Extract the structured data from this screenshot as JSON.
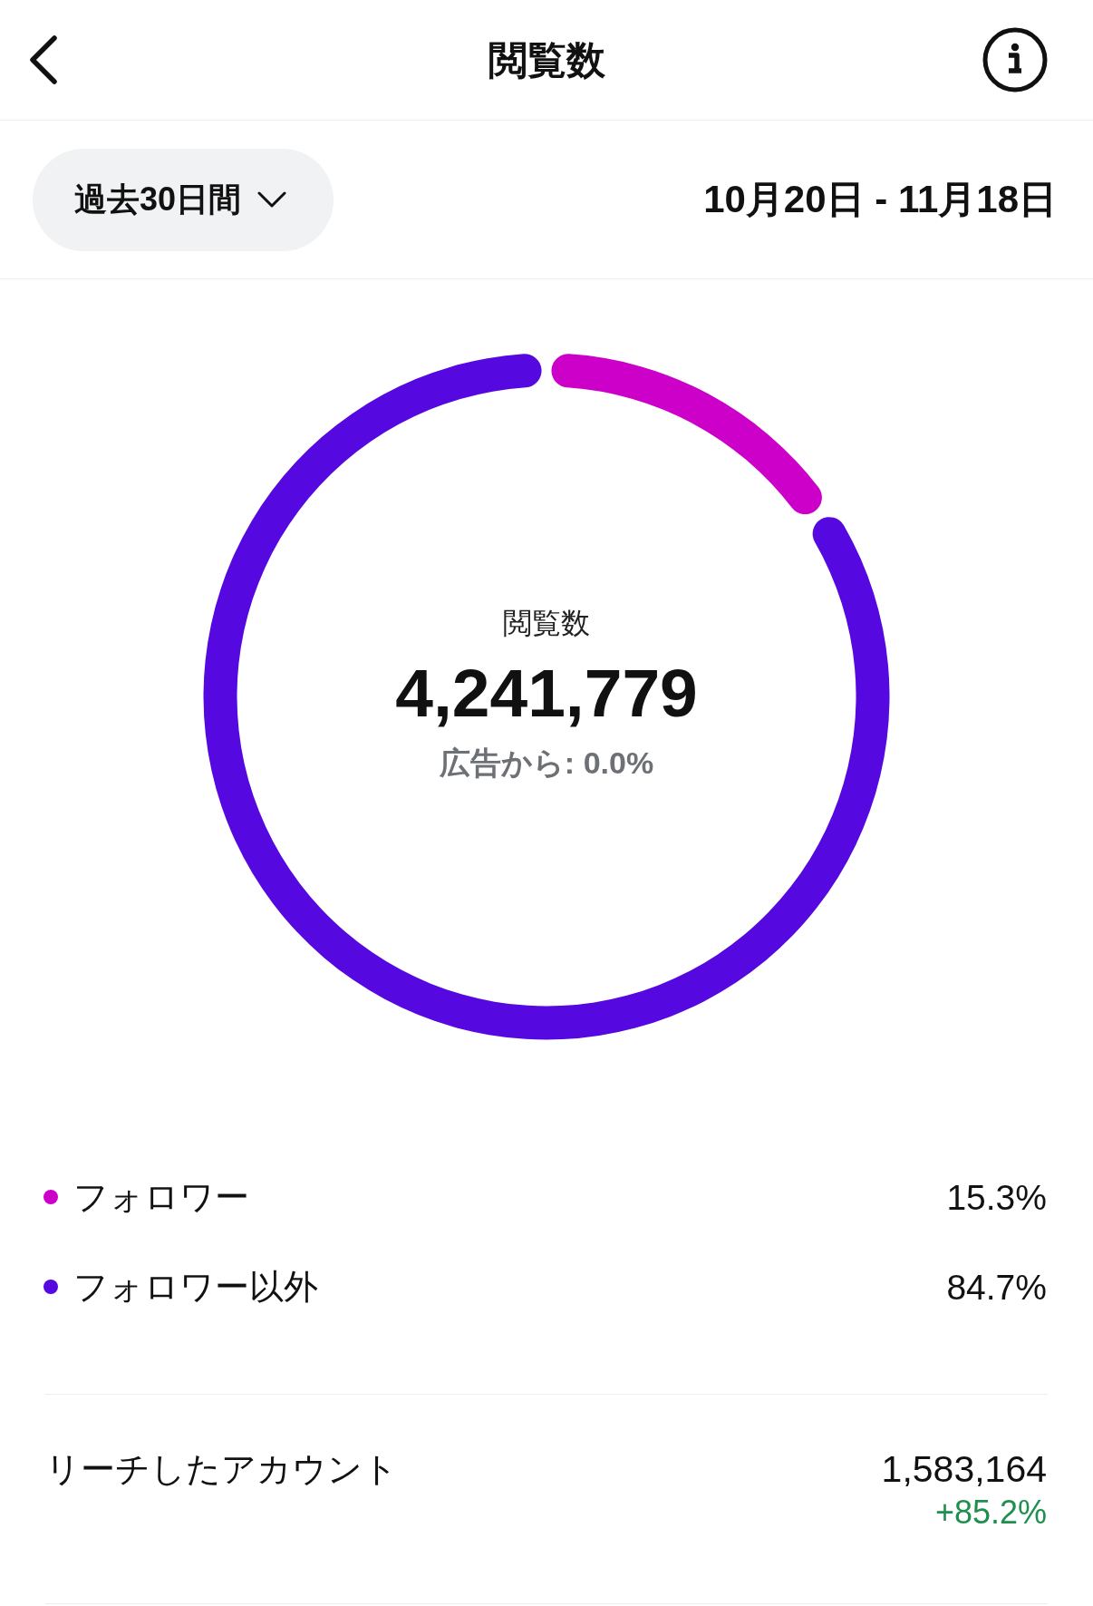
{
  "header": {
    "title": "閲覧数"
  },
  "filter": {
    "period": "過去30日間",
    "date_range": "10月20日 - 11月18日"
  },
  "summary": {
    "label": "閲覧数",
    "total": "4,241,779",
    "ads_share": "広告から: 0.0%",
    "chart_data": {
      "type": "donut",
      "categories": [
        "フォロワー",
        "フォロワー以外"
      ],
      "values": [
        15.3,
        84.7
      ]
    }
  },
  "legend": [
    {
      "value": "15.3%",
      "color": "#cc00c8"
    },
    {
      "value": "84.7%",
      "color": "#5508e0"
    }
  ],
  "metrics": [
    {
      "label": "リーチしたアカウント",
      "value": "1,583,164",
      "change": "+85.2%"
    }
  ]
}
